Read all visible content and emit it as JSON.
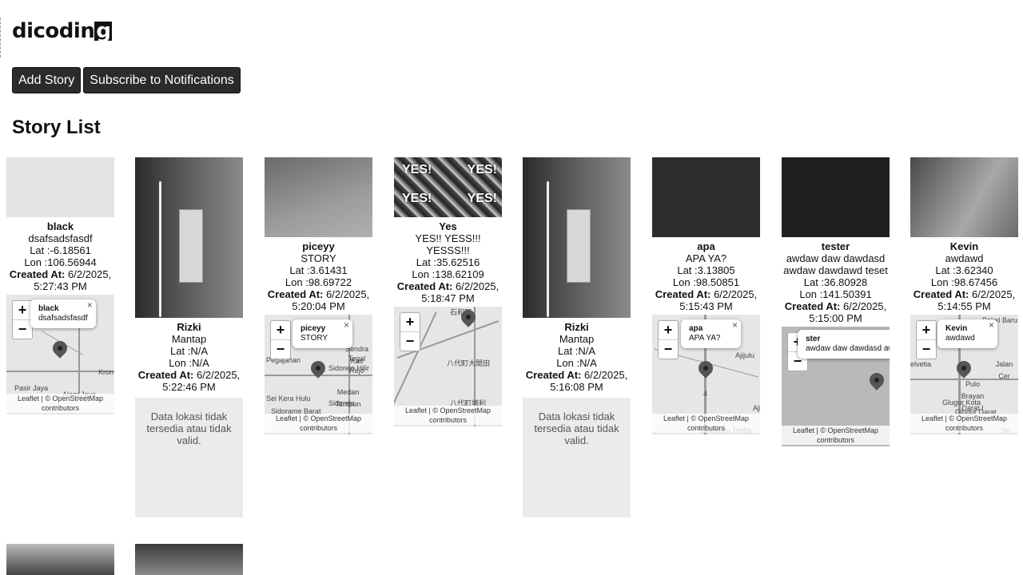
{
  "logo": {
    "prefix": "dicodin",
    "boxed": "g"
  },
  "buttons": {
    "add_story": "Add Story",
    "subscribe": "Subscribe to Notifications"
  },
  "page_title": "Story List",
  "labels": {
    "lat": "Lat :",
    "lon": "Lon :",
    "created_at": "Created At:",
    "attribution_1": "Leaflet | © OpenStreetMap",
    "attribution_2": "contributors",
    "zoom_in": "+",
    "zoom_out": "−",
    "close": "×"
  },
  "stories": [
    {
      "name": "black",
      "description": "dsafsadsfasdf",
      "lat": "-6.18561",
      "lon": "106.56944",
      "created_date": "6/2/2025,",
      "created_time": "5:27:43 PM",
      "map": true,
      "map_labels": [
        "Pasir Jaya",
        "Alam Jaya",
        "Kron"
      ]
    },
    {
      "name": "Rizki",
      "description": "Mantap",
      "lat": "N/A",
      "lon": "N/A",
      "created_date": "6/2/2025,",
      "created_time": "5:22:46 PM",
      "map": false,
      "no_location": "Data lokasi tidak tersedia atau tidak valid."
    },
    {
      "name": "piceyy",
      "description": "STORY",
      "lat": "3.61431",
      "lon": "98.69722",
      "created_date": "6/2/2025,",
      "created_time": "5:20:04 PM",
      "map": true,
      "map_labels": [
        "Sendra Kas",
        "Tegal Rejo",
        "Pegajahan",
        "Sidorejo Hilir",
        "Sei Kera Hulu",
        "Medan Tembun",
        "Sidorejo",
        "Sidorame Barat"
      ]
    },
    {
      "name": "Yes",
      "description": "YES!! YESS!!! YESSS!!!",
      "lat": "35.62516",
      "lon": "138.62109",
      "created_date": "6/2/2025,",
      "created_time": "5:18:47 PM",
      "map": true,
      "map_labels": [
        "八代町大間田",
        "八代町増利",
        "石和町"
      ]
    },
    {
      "name": "Rizki",
      "description": "Mantap",
      "lat": "N/A",
      "lon": "N/A",
      "created_date": "6/2/2025,",
      "created_time": "5:16:08 PM",
      "map": false,
      "no_location": "Data lokasi tidak tersedia atau tidak valid."
    },
    {
      "name": "apa",
      "description": "APA YA?",
      "lat": "3.13805",
      "lon": "98.50851",
      "created_date": "6/2/2025,",
      "created_time": "5:15:43 PM",
      "map": true,
      "map_labels": [
        "Ajijulu",
        "Aji",
        "4",
        "Sukanalu Teriba"
      ]
    },
    {
      "name": "tester",
      "description": "awdaw daw dawdasd awdaw dawdawd teset",
      "lat": "36.80928",
      "lon": "141.50391",
      "created_date": "6/2/2025,",
      "created_time": "5:15:00 PM",
      "map": true,
      "map_labels": []
    },
    {
      "name": "Kevin",
      "description": "awdawd",
      "lat": "3.62340",
      "lon": "98.67456",
      "created_date": "6/2/2025,",
      "created_time": "5:14:55 PM",
      "map": true,
      "map_labels": [
        "Pekel Baru",
        "Jalan Cer",
        "Pulo Brayan Darat I",
        "Glugur Kota",
        "Glugur Darat",
        "elvetia",
        "Sei Kera"
      ]
    }
  ],
  "popups": [
    {
      "title": "black",
      "text": "dsafsadsfasdf"
    },
    {
      "title": "piceyy",
      "text": "STORY"
    },
    {
      "title": "apa",
      "text": "APA YA?"
    },
    {
      "title": "ster",
      "text": "awdaw daw dawdasd awda"
    },
    {
      "title": "Kevin",
      "text": "awdawd"
    }
  ],
  "colors": {
    "button_bg": "#2b2b2b",
    "map_bg": "#e6e6e6",
    "placeholder_bg": "#ebebeb"
  }
}
